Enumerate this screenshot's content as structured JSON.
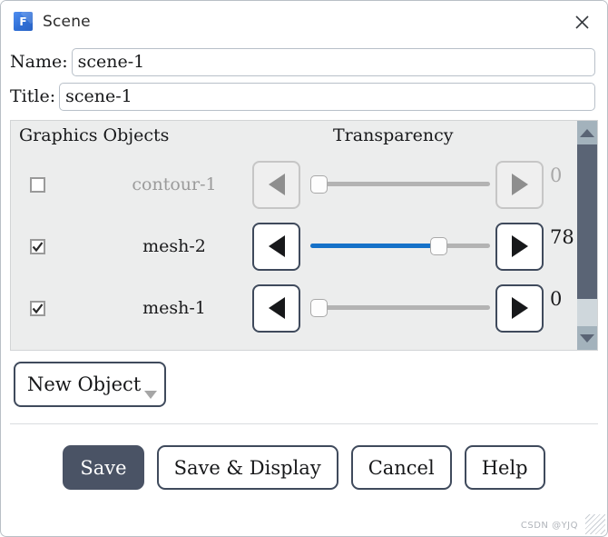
{
  "window": {
    "title": "Scene",
    "app_icon": "freecad-f-icon",
    "close_icon": "close-icon"
  },
  "form": {
    "name": {
      "label": "Name:",
      "value": "scene-1",
      "placeholder": ""
    },
    "title": {
      "label": "Title:",
      "value": "scene-1",
      "placeholder": ""
    }
  },
  "objects_panel": {
    "headers": {
      "objects": "Graphics Objects",
      "transparency": "Transparency"
    },
    "rows": [
      {
        "name": "contour-1",
        "checked": false,
        "enabled": false,
        "transparency": 0,
        "value_label": "0",
        "dec_icon": "triangle-left-icon",
        "inc_icon": "triangle-right-icon"
      },
      {
        "name": "mesh-2",
        "checked": true,
        "enabled": true,
        "transparency": 78,
        "value_label": "78",
        "dec_icon": "triangle-left-icon",
        "inc_icon": "triangle-right-icon"
      },
      {
        "name": "mesh-1",
        "checked": true,
        "enabled": true,
        "transparency": 0,
        "value_label": "0",
        "dec_icon": "triangle-left-icon",
        "inc_icon": "triangle-right-icon"
      }
    ],
    "scrollbar": {
      "up_icon": "scroll-up-arrow-icon",
      "down_icon": "scroll-down-arrow-icon"
    }
  },
  "new_object": {
    "label": "New Object",
    "caret_icon": "chevron-down-icon"
  },
  "footer": {
    "buttons": [
      {
        "label": "Save",
        "primary": true
      },
      {
        "label": "Save & Display",
        "primary": false
      },
      {
        "label": "Cancel",
        "primary": false
      },
      {
        "label": "Help",
        "primary": false
      }
    ]
  },
  "watermark": "CSDN @YJQ",
  "colors": {
    "accent_blue": "#1571c8",
    "primary_button": "#4a5365",
    "panel_bg": "#eceded",
    "scrollbar_thumb": "#5a6475",
    "scrollbar_track": "#cfd7dc",
    "border_dark": "#3f4a5c"
  }
}
